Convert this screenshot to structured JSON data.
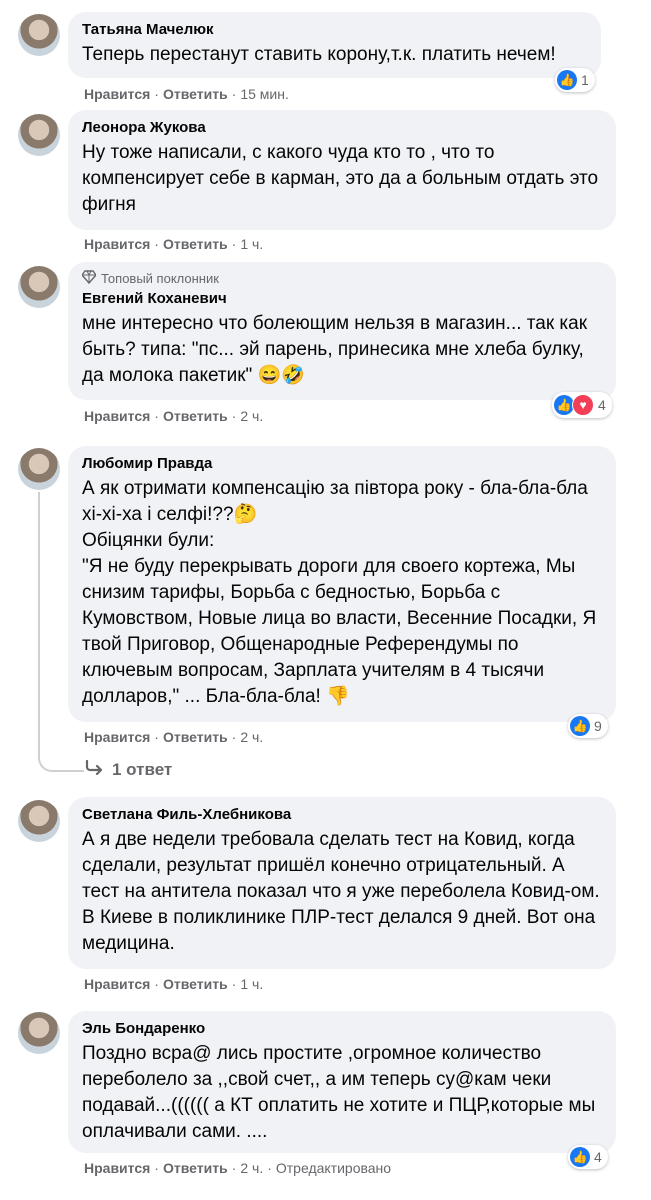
{
  "comments": [
    {
      "author": "Татьяна Мачелюк",
      "text": "Теперь перестанут ставить корону,т.к. платить нечем!",
      "like": "Нравится",
      "reply": "Ответить",
      "time": "15 мин.",
      "reaction_count": "1"
    },
    {
      "author": "Леонора Жукова",
      "text": "Ну тоже написали, с какого чуда кто то , что то компенсирует себе в карман, это да а больным отдать это фигня",
      "like": "Нравится",
      "reply": "Ответить",
      "time": "1 ч."
    },
    {
      "badge": "Топовый поклонник",
      "author": "Евгений Коханевич",
      "text": "мне интересно что болеющим нельзя в магазин... так как быть? типа: \"пс... эй парень, принесика мне хлеба булку, да молока пакетик\" 😄🤣",
      "like": "Нравится",
      "reply": "Ответить",
      "time": "2 ч.",
      "reaction_count": "4"
    },
    {
      "author": "Любомир Правда",
      "text": "А як отримати компенсацію за півтора року - бла-бла-бла хі-хі-ха і селфі!??🤔\nОбіцянки були:\n\"Я не буду перекрывать дороги для своего кортежа, Мы снизим тарифы, Борьба с бедностью, Борьба с Кумовством, Новые лица во власти, Весенние Посадки, Я твой Приговор, Общенародные Референдумы по ключевым вопросам, Зарплата учителям в 4 тысячи долларов,\" ... Бла-бла-бла! 👎",
      "like": "Нравится",
      "reply": "Ответить",
      "time": "2 ч.",
      "reaction_count": "9",
      "replies_label": "1 ответ"
    },
    {
      "author": "Светлана Филь-Хлебникова",
      "text": "А я две недели требовала сделать тест на Ковид, когда сделали, результат пришёл конечно отрицательный. А тест на антитела показал что я уже переболела Ковид-ом. В Киеве в поликлинике ПЛР-тест делался 9 дней. Вот она медицина.",
      "like": "Нравится",
      "reply": "Ответить",
      "time": "1 ч."
    },
    {
      "author": "Эль Бондаренко",
      "text": "Поздно всра@ лись простите ,огромное количество переболело за ,,свой счет,, а им теперь су@кам чеки подавай...(((((( а КТ оплатить не хотите и ПЦР,которые мы оплачивали сами. ....",
      "like": "Нравится",
      "reply": "Ответить",
      "time": "2 ч.",
      "edited": "Отредактировано",
      "reaction_count": "4"
    }
  ],
  "icons": {
    "like": "like-icon",
    "love": "love-icon",
    "badge": "diamond-icon",
    "reply_arrow": "reply-arrow-icon"
  },
  "colors": {
    "bubble": "#f0f2f5",
    "meta": "#65676b",
    "like_blue": "#1877f2",
    "love_red": "#f33e58"
  }
}
